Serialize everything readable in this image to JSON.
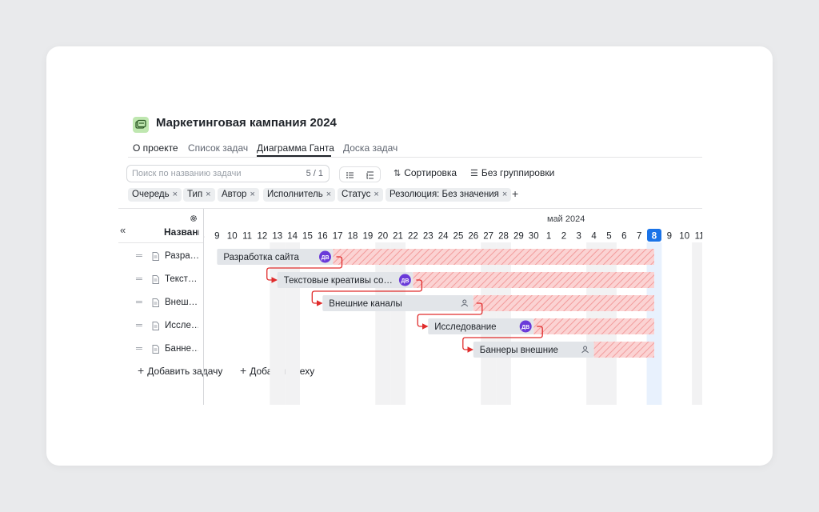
{
  "project": {
    "title": "Маркетинговая кампания 2024",
    "icon": "project-folder-icon"
  },
  "tabs": [
    {
      "label": "О проекте",
      "active": false
    },
    {
      "label": "Список задач",
      "active": false
    },
    {
      "label": "Диаграмма Ганта",
      "active": true
    },
    {
      "label": "Доска задач",
      "active": false
    }
  ],
  "toolbar": {
    "search_placeholder": "Поиск по названию задачи",
    "search_counter": "5 / 1",
    "sort_label": "Сортировка",
    "group_label": "Без группировки"
  },
  "filters": [
    {
      "label": "Очередь"
    },
    {
      "label": "Тип"
    },
    {
      "label": "Автор"
    },
    {
      "label": "Исполнитель"
    },
    {
      "label": "Статус"
    },
    {
      "label": "Резолюция: Без значения"
    }
  ],
  "filter_remove": "×",
  "filter_add": "+",
  "gantt": {
    "collapse": "«",
    "name_column_header": "Название",
    "month_label": "май 2024",
    "today_day": "8",
    "day_labels": [
      "8",
      "9",
      "10",
      "11",
      "12",
      "13",
      "14",
      "15",
      "16",
      "17",
      "18",
      "19",
      "20",
      "21",
      "22",
      "23",
      "24",
      "25",
      "26",
      "27",
      "28",
      "29",
      "30",
      "1",
      "2",
      "3",
      "4",
      "5",
      "6",
      "7",
      "8",
      "9",
      "10",
      "11"
    ],
    "weekend_day_indices": [
      5,
      6,
      12,
      13,
      19,
      20,
      26,
      27,
      33
    ],
    "today_index": 30,
    "tasks": [
      {
        "name": "Разработка сайта",
        "short": "Разра…",
        "start": 1.5,
        "end": 9.2,
        "assignee": "ДВ",
        "overdue_end": 30.5
      },
      {
        "name": "Текстовые креативы со…",
        "short": "Текст…",
        "start": 5.5,
        "end": 14.5,
        "assignee": "ДВ",
        "overdue_end": 30.5
      },
      {
        "name": "Внешние каналы",
        "short": "Внеш…",
        "start": 8.5,
        "end": 18.5,
        "assignee": "",
        "overdue_end": 30.5
      },
      {
        "name": "Исследование",
        "short": "Иссле…",
        "start": 15.5,
        "end": 22.5,
        "assignee": "ДВ",
        "overdue_end": 30.5
      },
      {
        "name": "Баннеры внешние",
        "short": "Банне…",
        "start": 18.5,
        "end": 26.5,
        "assignee": "",
        "overdue_end": 30.5
      }
    ],
    "add_task_label": "Добавить задачу",
    "add_milestone_label": "Добавить веху"
  },
  "colors": {
    "accent": "#1a73e8",
    "bar": "#e2e5e9",
    "overdue": "#f27b7b",
    "avatar": "#6a3ad9",
    "dependency": "#e02c2c"
  }
}
